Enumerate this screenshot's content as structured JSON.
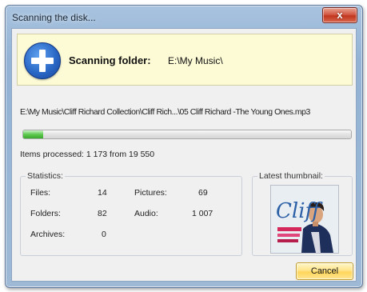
{
  "window": {
    "title": "Scanning the disk...",
    "close_label": "x"
  },
  "banner": {
    "icon": "add-plus-icon",
    "label": "Scanning folder:",
    "folder": "E:\\My Music\\"
  },
  "current_file": "E:\\My Music\\Cliff Richard Collection\\Cliff Rich...\\05 Cliff Richard -The Young Ones.mp3",
  "progress": {
    "processed": 1173,
    "total": 19550,
    "fraction": 0.06
  },
  "items_processed_text": "Items processed: 1 173 from 19 550",
  "statistics": {
    "legend": "Statistics:",
    "files_label": "Files:",
    "files_value": "14",
    "folders_label": "Folders:",
    "folders_value": "82",
    "archives_label": "Archives:",
    "archives_value": "0",
    "pictures_label": "Pictures:",
    "pictures_value": "69",
    "audio_label": "Audio:",
    "audio_value": "1 007"
  },
  "thumbnail": {
    "legend": "Latest thumbnail:",
    "cover_text": "Cliff"
  },
  "buttons": {
    "cancel": "Cancel"
  },
  "colors": {
    "banner_bg": "#fdfbd6",
    "progress_fill": "#3aa92c",
    "cancel_bg": "#ffd65c",
    "close_bg": "#c1371f"
  }
}
